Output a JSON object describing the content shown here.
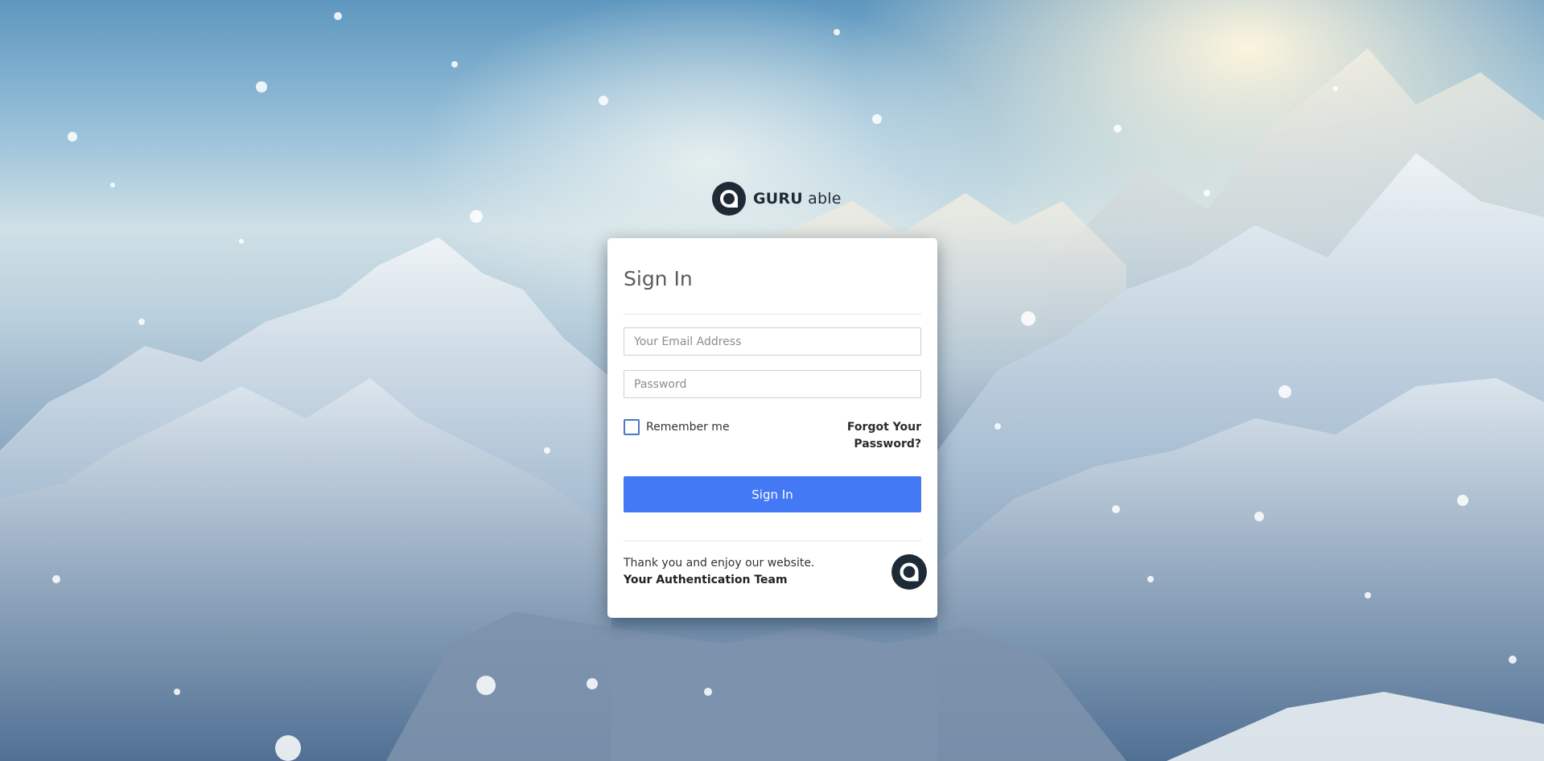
{
  "brand": {
    "name_bold": "GURU",
    "name_light": "able"
  },
  "form": {
    "title": "Sign In",
    "email_placeholder": "Your Email Address",
    "email_value": "",
    "password_placeholder": "Password",
    "password_value": "",
    "remember_label": "Remember me",
    "remember_checked": false,
    "forgot_label": "Forgot Your Password?",
    "submit_label": "Sign In"
  },
  "footer": {
    "message": "Thank you and enjoy our website.",
    "signature": "Your Authentication Team"
  },
  "icons": {
    "brand_logo": "guru-able-logo-icon",
    "footer_logo": "guru-able-logo-icon"
  },
  "colors": {
    "primary_button": "#4479f6",
    "checkbox_border": "#4a78c5",
    "logo_dark": "#1f2a37"
  }
}
